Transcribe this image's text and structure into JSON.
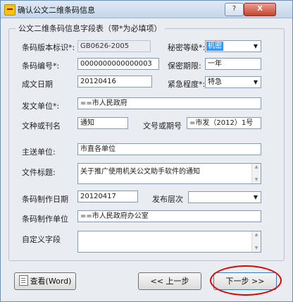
{
  "window": {
    "title": "确认公文二维条码信息",
    "help_label": "?",
    "close_label": "X"
  },
  "group": {
    "title": "公文二维条码信息字段表（带*为必填项）"
  },
  "fields": {
    "version_label": "条码版本标识*:",
    "version_value": "GB0626-2005",
    "secret_label": "秘密等级*:",
    "secret_value": "机密",
    "code_label": "条码编号*:",
    "code_value": "0000000000000003",
    "keep_label": "保密期限:",
    "keep_value": "一年",
    "date_label": "成文日期",
    "date_value": "20120416",
    "urgency_label": "紧急程度*:",
    "urgency_value": "特急",
    "sender_label": "发文单位*:",
    "sender_value": "==市人民政府",
    "type_label": "文种或刊名",
    "type_value": "通知",
    "docno_label": "文号或期号",
    "docno_value": "=市发（2012）1号",
    "main_label": "主送单位:",
    "main_value": "市直各单位",
    "doctitle_label": "文件标题:",
    "doctitle_value": "关于推广使用机关公文助手软件的通知",
    "makedate_label": "条码制作日期",
    "makedate_value": "20120417",
    "level_label": "发布层次",
    "level_value": "",
    "maker_label": "条码制作单位",
    "maker_value": "==市人民政府办公室",
    "custom_label": "自定义字段",
    "custom_value": ""
  },
  "buttons": {
    "view_word": "查看(Word)",
    "prev": "<< 上一步",
    "next": "下一步 >>"
  },
  "icons": {
    "combo_arrow": "▼",
    "scroll_up": "▲",
    "scroll_down": "▼"
  },
  "colors": {
    "annotation_circle": "#e60000",
    "selection": "#3399ff"
  }
}
